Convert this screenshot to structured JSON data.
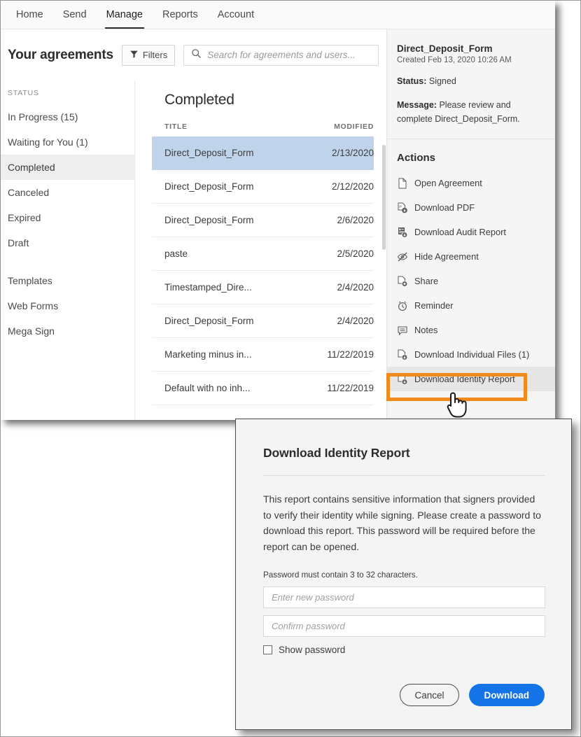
{
  "nav": {
    "items": [
      {
        "label": "Home",
        "active": false
      },
      {
        "label": "Send",
        "active": false
      },
      {
        "label": "Manage",
        "active": true
      },
      {
        "label": "Reports",
        "active": false
      },
      {
        "label": "Account",
        "active": false
      }
    ]
  },
  "header": {
    "title": "Your agreements",
    "filters_label": "Filters",
    "search_placeholder": "Search for agreements and users..."
  },
  "sidebar": {
    "heading": "STATUS",
    "items": [
      {
        "label": "In Progress (15)",
        "selected": false
      },
      {
        "label": "Waiting for You (1)",
        "selected": false
      },
      {
        "label": "Completed",
        "selected": true
      },
      {
        "label": "Canceled",
        "selected": false
      },
      {
        "label": "Expired",
        "selected": false
      },
      {
        "label": "Draft",
        "selected": false
      }
    ],
    "items2": [
      {
        "label": "Templates"
      },
      {
        "label": "Web Forms"
      },
      {
        "label": "Mega Sign"
      }
    ]
  },
  "list": {
    "title": "Completed",
    "columns": [
      "TITLE",
      "MODIFIED"
    ],
    "rows": [
      {
        "title": "Direct_Deposit_Form",
        "modified": "2/13/2020",
        "selected": true
      },
      {
        "title": "Direct_Deposit_Form",
        "modified": "2/12/2020",
        "selected": false
      },
      {
        "title": "Direct_Deposit_Form",
        "modified": "2/6/2020",
        "selected": false
      },
      {
        "title": "paste",
        "modified": "2/5/2020",
        "selected": false
      },
      {
        "title": "Timestamped_Dire...",
        "modified": "2/4/2020",
        "selected": false
      },
      {
        "title": "Direct_Deposit_Form",
        "modified": "2/4/2020",
        "selected": false
      },
      {
        "title": "Marketing minus in...",
        "modified": "11/22/2019",
        "selected": false
      },
      {
        "title": "Default with no inh...",
        "modified": "11/22/2019",
        "selected": false
      }
    ]
  },
  "detail": {
    "name": "Direct_Deposit_Form",
    "created": "Created Feb 13, 2020 10:26 AM",
    "status_label": "Status:",
    "status_value": "Signed",
    "message_label": "Message:",
    "message_value": "Please review and complete Direct_Deposit_Form.",
    "actions_title": "Actions",
    "actions": [
      {
        "label": "Open Agreement",
        "icon": "document-icon",
        "hovered": false
      },
      {
        "label": "Download PDF",
        "icon": "pdf-download-icon",
        "hovered": false
      },
      {
        "label": "Download Audit Report",
        "icon": "audit-download-icon",
        "hovered": false
      },
      {
        "label": "Hide Agreement",
        "icon": "eye-off-icon",
        "hovered": false
      },
      {
        "label": "Share",
        "icon": "share-document-icon",
        "hovered": false
      },
      {
        "label": "Reminder",
        "icon": "clock-icon",
        "hovered": false
      },
      {
        "label": "Notes",
        "icon": "note-icon",
        "hovered": false
      },
      {
        "label": "Download Individual Files (1)",
        "icon": "file-download-icon",
        "hovered": false
      },
      {
        "label": "Download Identity Report",
        "icon": "file-download-icon",
        "hovered": true
      }
    ]
  },
  "highlight": {
    "color": "#f08a1c"
  },
  "modal": {
    "title": "Download Identity Report",
    "body": "This report contains sensitive information that signers provided to verify their identity while signing. Please create a password to download this report. This password will be required before the report can be opened.",
    "note": "Password must contain 3 to 32 characters.",
    "password_placeholder": "Enter new password",
    "password_value": "",
    "confirm_placeholder": "Confirm password",
    "confirm_value": "",
    "show_password_label": "Show password",
    "show_password_checked": false,
    "cancel_label": "Cancel",
    "download_label": "Download",
    "primary_color": "#1473e6"
  }
}
